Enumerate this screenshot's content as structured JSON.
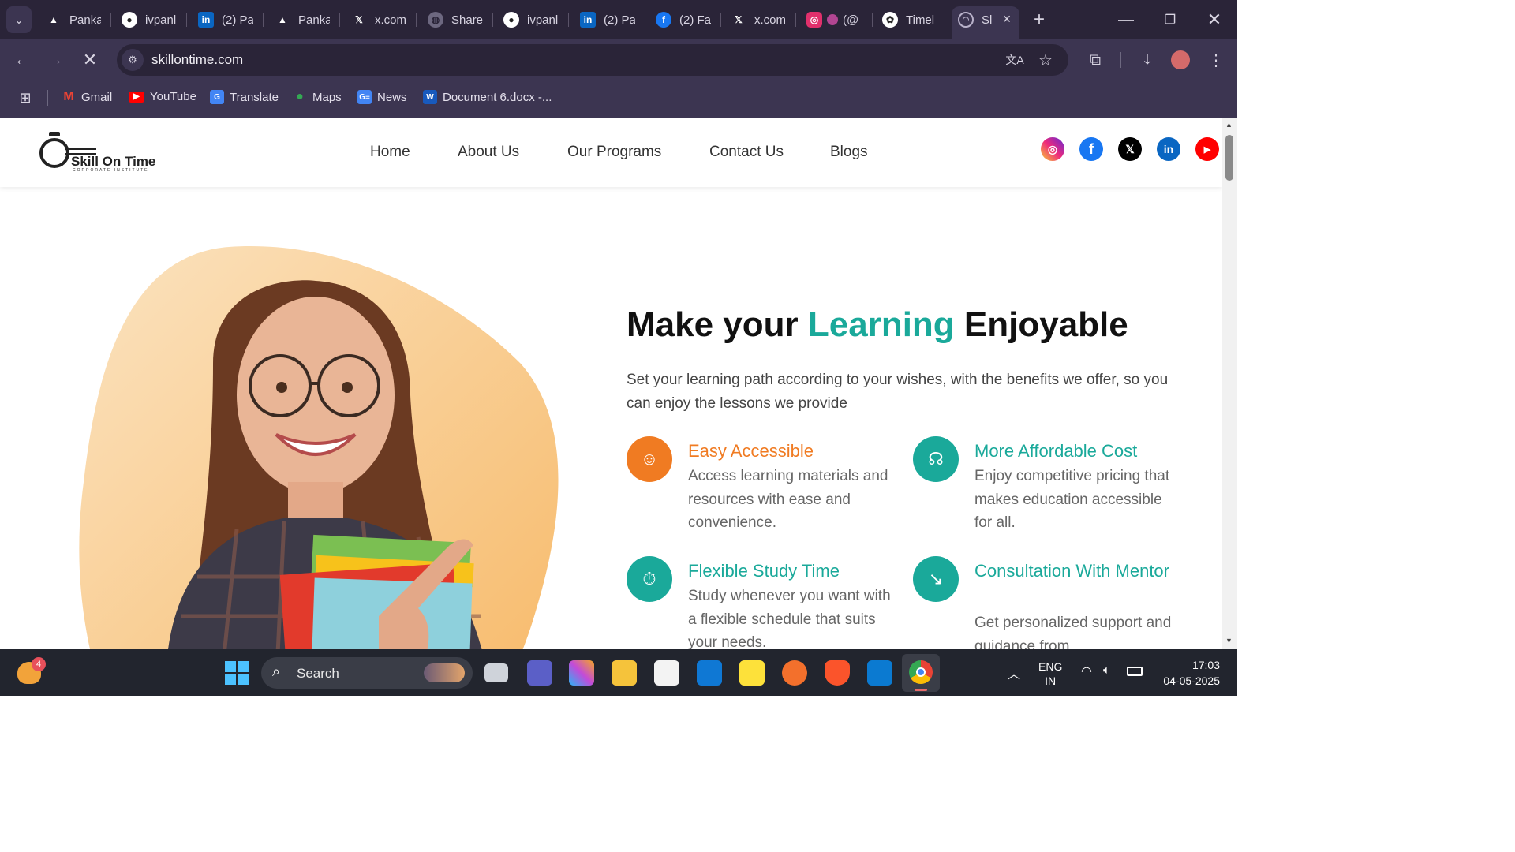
{
  "browser": {
    "tabs": [
      "Panka",
      "ivpanl",
      "(2) Pa",
      "Panka",
      "x.com",
      "Share",
      "ivpanl",
      "(2) Pa",
      "(2) Fa",
      "x.com",
      "(@",
      "Timel",
      "Sl"
    ],
    "url": "skillontime.com",
    "bookmarks": [
      "Gmail",
      "YouTube",
      "Translate",
      "Maps",
      "News",
      "Document 6.docx -..."
    ]
  },
  "site": {
    "logo_main": "Skill On Time",
    "logo_sub": "CORPORATE INSTITUTE",
    "nav": [
      "Home",
      "About Us",
      "Our Programs",
      "Contact Us",
      "Blogs"
    ],
    "social": [
      "instagram-icon",
      "facebook-icon",
      "x-icon",
      "linkedin-icon",
      "youtube-icon"
    ],
    "hero": {
      "title_pre": "Make your ",
      "title_highlight": "Learning",
      "title_post": " Enjoyable",
      "subtitle": "Set your learning path according to your wishes, with the benefits we offer, so you can enjoy the lessons we provide"
    },
    "features": [
      {
        "title": "Easy Accessible",
        "text": "Access learning materials and resources with ease and convenience."
      },
      {
        "title": "More Affordable Cost",
        "text": "Enjoy competitive pricing that makes education accessible for all."
      },
      {
        "title": "Flexible Study Time",
        "text": "Study whenever you want with a flexible schedule that suits your needs."
      },
      {
        "title": "Consultation With Mentor",
        "text": "Get personalized support and guidance from"
      }
    ]
  },
  "taskbar": {
    "search": "Search",
    "lang1": "ENG",
    "lang2": "IN",
    "time": "17:03",
    "date": "04-05-2025",
    "weather_badge": "4"
  },
  "colors": {
    "teal": "#1aa99a",
    "orange": "#f07b22",
    "chrome": "#2a2438"
  }
}
